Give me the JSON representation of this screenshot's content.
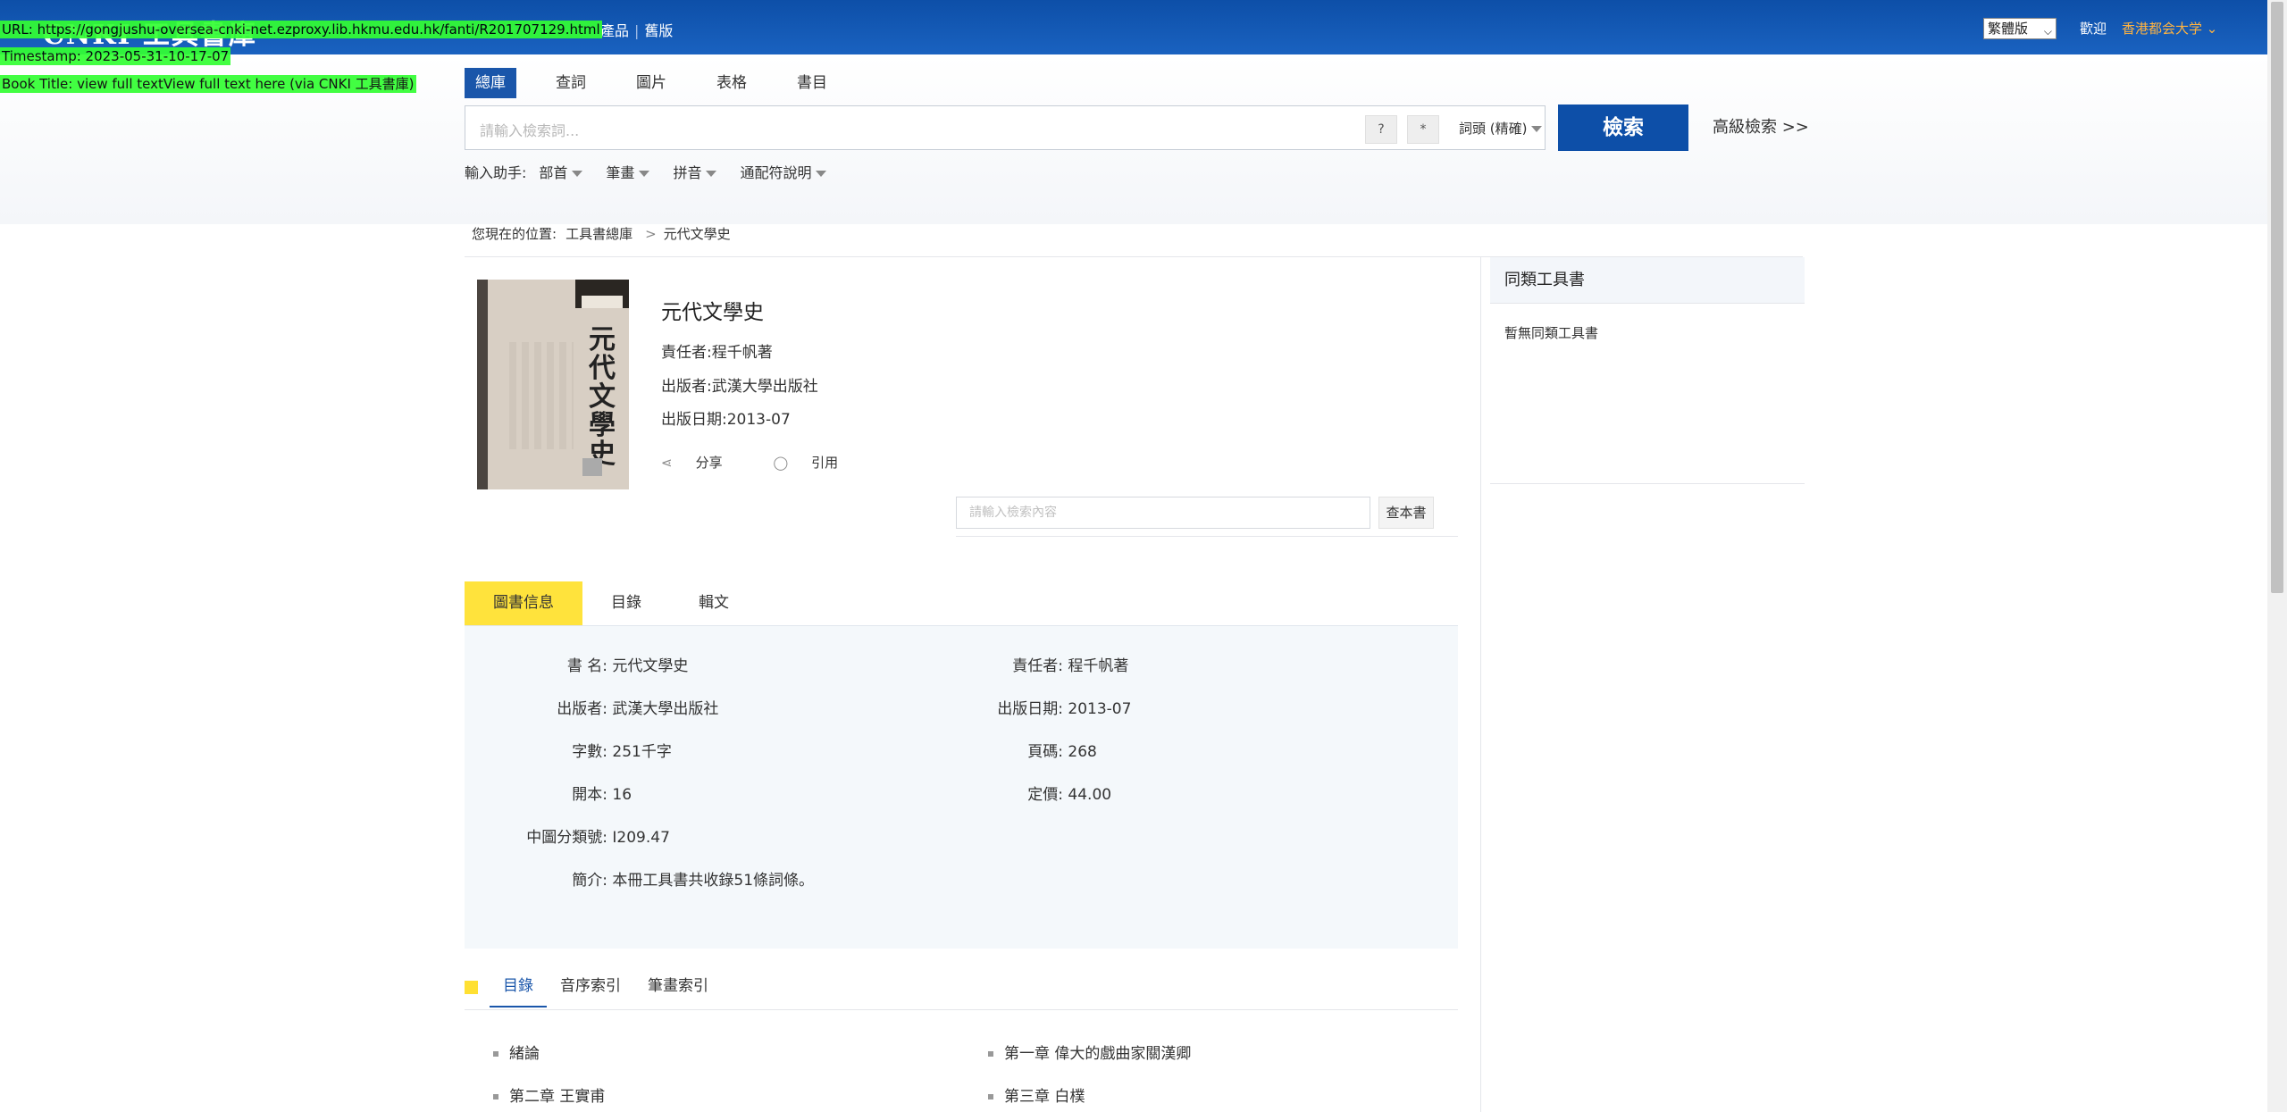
{
  "header": {
    "logo": "CNKI 工具書庫",
    "nav_link_1": "產品",
    "nav_link_2": "舊版",
    "language": "繁體版",
    "welcome": "歡迎",
    "institution": "香港都会大学"
  },
  "overlay": {
    "url": "URL: https://gongjushu-oversea-cnki-net.ezproxy.lib.hkmu.edu.hk/fanti/R201707129.html",
    "timestamp": "Timestamp: 2023-05-31-10-17-07",
    "book_title": "Book Title: view full textView full text here (via CNKI 工具書庫)"
  },
  "search": {
    "tabs": [
      "總庫",
      "查詞",
      "圖片",
      "表格",
      "書目"
    ],
    "placeholder": "請輸入檢索詞...",
    "q_button": "?",
    "star_button": "*",
    "match_mode": "詞頭 (精確)",
    "button_label": "檢索",
    "advanced": "高級檢索 >>",
    "helper_label": "輸入助手:",
    "helpers": [
      "部首",
      "筆畫",
      "拼音",
      "通配符說明"
    ]
  },
  "breadcrumb": {
    "label": "您現在的位置:",
    "root": "工具書總庫",
    "current": "元代文學史"
  },
  "book": {
    "cover_title": "元代文學史",
    "title": "元代文學史",
    "author_line": "責任者:程千帆著",
    "publisher_line": "出版者:武漢大學出版社",
    "date_line": "出版日期:2013-07",
    "share": "分享",
    "cite": "引用",
    "search_in_book_placeholder": "請輸入檢索內容",
    "search_in_book_button": "查本書"
  },
  "sidebar": {
    "title": "同類工具書",
    "empty": "暫無同類工具書"
  },
  "detail_tabs": [
    "圖書信息",
    "目錄",
    "輯文"
  ],
  "details": {
    "name_label": "書 名:",
    "name_value": "元代文學史",
    "author_label": "責任者:",
    "author_value": "程千帆著",
    "publisher_label": "出版者:",
    "publisher_value": "武漢大學出版社",
    "date_label": "出版日期:",
    "date_value": "2013-07",
    "words_label": "字數:",
    "words_value": "251千字",
    "pages_label": "頁碼:",
    "pages_value": "268",
    "format_label": "開本:",
    "format_value": "16",
    "price_label": "定價:",
    "price_value": "44.00",
    "clc_label": "中圖分類號:",
    "clc_value": "I209.47",
    "intro_label": "簡介:",
    "intro_value": "本冊工具書共收錄51條詞條。"
  },
  "toc": {
    "tabs": [
      "目錄",
      "音序索引",
      "筆畫索引"
    ],
    "items": [
      "緒論",
      "第一章 偉大的戲曲家關漢卿",
      "第二章 王實甫",
      "第三章 白樸"
    ]
  },
  "colors": {
    "header_blue": "#0d4fa8",
    "highlight_yellow": "#ffe33c",
    "institution_orange": "#ffb340"
  }
}
